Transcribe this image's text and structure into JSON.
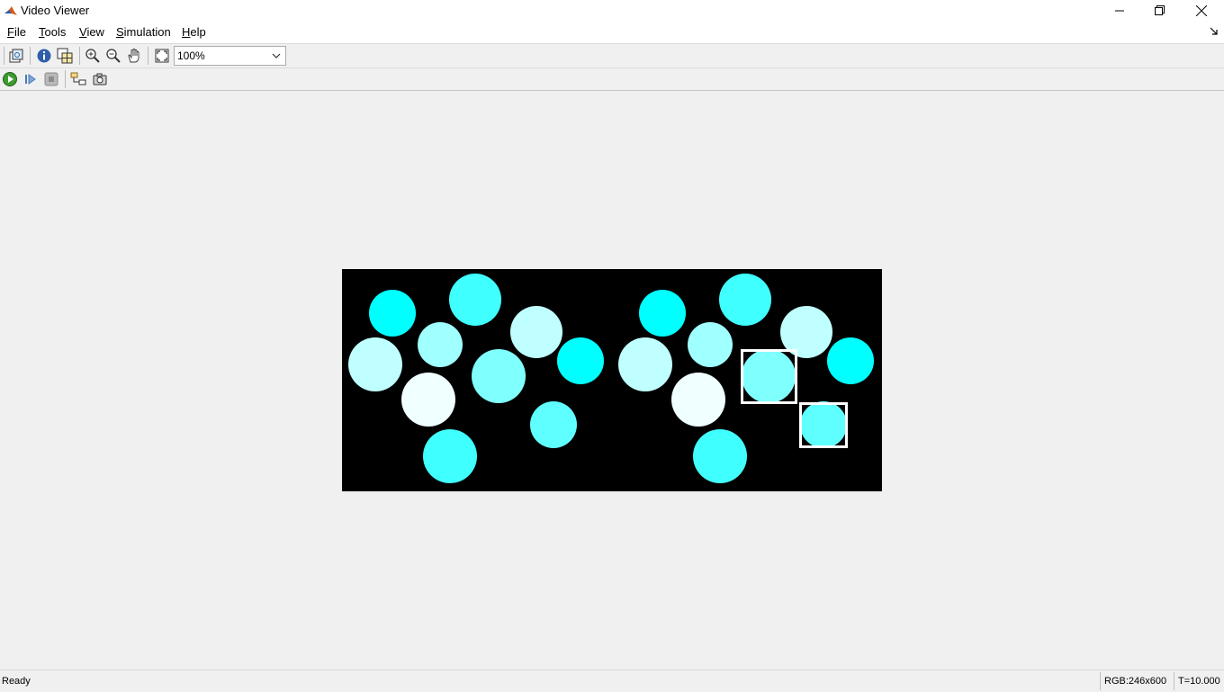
{
  "window": {
    "title": "Video Viewer",
    "minimize_icon": "minimize-icon",
    "restore_icon": "restore-icon",
    "close_icon": "close-icon"
  },
  "menu": {
    "items": [
      {
        "label": "File",
        "accel": "F",
        "rest": "ile"
      },
      {
        "label": "Tools",
        "accel": "T",
        "rest": "ools"
      },
      {
        "label": "View",
        "accel": "V",
        "rest": "iew"
      },
      {
        "label": "Simulation",
        "accel": "S",
        "rest": "imulation"
      },
      {
        "label": "Help",
        "accel": "H",
        "rest": "elp"
      }
    ]
  },
  "toolbar": {
    "zoom_value": "100%",
    "icons": [
      "print-to-figure-icon",
      "info-icon",
      "pixel-region-icon",
      "zoom-in-icon",
      "zoom-out-icon",
      "pan-hand-icon",
      "fit-to-view-icon"
    ],
    "sim_icons": [
      "run-icon",
      "step-forward-icon",
      "stop-icon",
      "highlight-model-icon",
      "snapshot-icon"
    ]
  },
  "video": {
    "background": "#000000",
    "colors": [
      "#00ffff",
      "#40ffff",
      "#80ffff",
      "#c0ffff",
      "#f0ffff",
      "#a0ffff",
      "#60ffff"
    ]
  },
  "status": {
    "text": "Ready",
    "dims": "RGB:246x600",
    "time": "T=10.000"
  }
}
